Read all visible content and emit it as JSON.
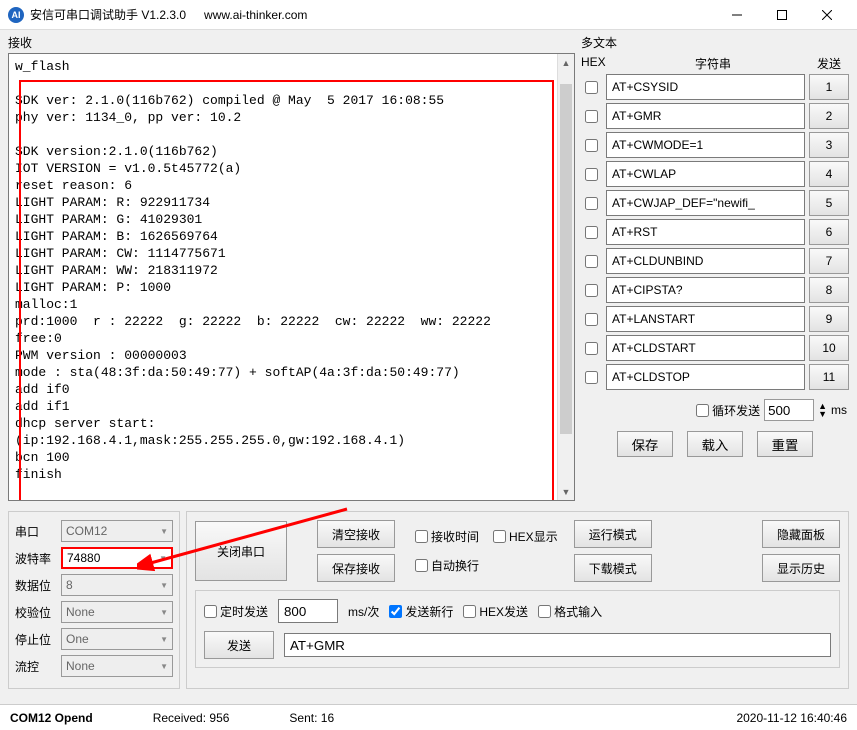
{
  "titlebar": {
    "app_icon_text": "AI",
    "title": "安信可串口调试助手 V1.2.3.0",
    "url": "www.ai-thinker.com"
  },
  "receive": {
    "label": "接收",
    "text": "w_flash\n\nSDK ver: 2.1.0(116b762) compiled @ May  5 2017 16:08:55\nphy ver: 1134_0, pp ver: 10.2\n\nSDK version:2.1.0(116b762)\nIOT VERSION = v1.0.5t45772(a)\nreset reason: 6\nLIGHT PARAM: R: 922911734\nLIGHT PARAM: G: 41029301\nLIGHT PARAM: B: 1626569764\nLIGHT PARAM: CW: 1114775671\nLIGHT PARAM: WW: 218311972\nLIGHT PARAM: P: 1000\nmalloc:1\nprd:1000  r : 22222  g: 22222  b: 22222  cw: 22222  ww: 22222\nfree:0\nPWM version : 00000003\nmode : sta(48:3f:da:50:49:77) + softAP(4a:3f:da:50:49:77)\nadd if0\nadd if1\ndhcp server start:\n(ip:192.168.4.1,mask:255.255.255.0,gw:192.168.4.1)\nbcn 100\nfinish"
  },
  "multi": {
    "header": "多文本",
    "col_hex": "HEX",
    "col_str": "字符串",
    "col_send": "发送",
    "commands": [
      {
        "text": "AT+CSYSID",
        "num": "1"
      },
      {
        "text": "AT+GMR",
        "num": "2"
      },
      {
        "text": "AT+CWMODE=1",
        "num": "3"
      },
      {
        "text": "AT+CWLAP",
        "num": "4"
      },
      {
        "text": "AT+CWJAP_DEF=\"newifi_",
        "num": "5"
      },
      {
        "text": "AT+RST",
        "num": "6"
      },
      {
        "text": "AT+CLDUNBIND",
        "num": "7"
      },
      {
        "text": "AT+CIPSTA?",
        "num": "8"
      },
      {
        "text": "AT+LANSTART",
        "num": "9"
      },
      {
        "text": "AT+CLDSTART",
        "num": "10"
      },
      {
        "text": "AT+CLDSTOP",
        "num": "11"
      }
    ],
    "loop_label": "循环发送",
    "loop_value": "500",
    "loop_unit": "ms",
    "btn_save": "保存",
    "btn_load": "载入",
    "btn_reset": "重置"
  },
  "port": {
    "rows": [
      {
        "label": "串口",
        "value": "COM12"
      },
      {
        "label": "波特率",
        "value": "74880"
      },
      {
        "label": "数据位",
        "value": "8"
      },
      {
        "label": "校验位",
        "value": "None"
      },
      {
        "label": "停止位",
        "value": "One"
      },
      {
        "label": "流控",
        "value": "None"
      }
    ]
  },
  "controls": {
    "close_port": "关闭串口",
    "clear_recv": "清空接收",
    "save_recv": "保存接收",
    "recv_time": "接收时间",
    "hex_show": "HEX显示",
    "run_mode": "运行模式",
    "hide_panel": "隐藏面板",
    "auto_wrap": "自动换行",
    "down_mode": "下载模式",
    "show_history": "显示历史",
    "timed_send": "定时发送",
    "timed_value": "800",
    "timed_unit": "ms/次",
    "send_newline": "发送新行",
    "hex_send": "HEX发送",
    "format_input": "格式输入",
    "send_btn": "发送",
    "send_value": "AT+GMR"
  },
  "statusbar": {
    "port": "COM12 Opend",
    "received_label": "Received: ",
    "received_value": "956",
    "sent_label": "Sent: ",
    "sent_value": "16",
    "timestamp": "2020-11-12 16:40:46"
  }
}
